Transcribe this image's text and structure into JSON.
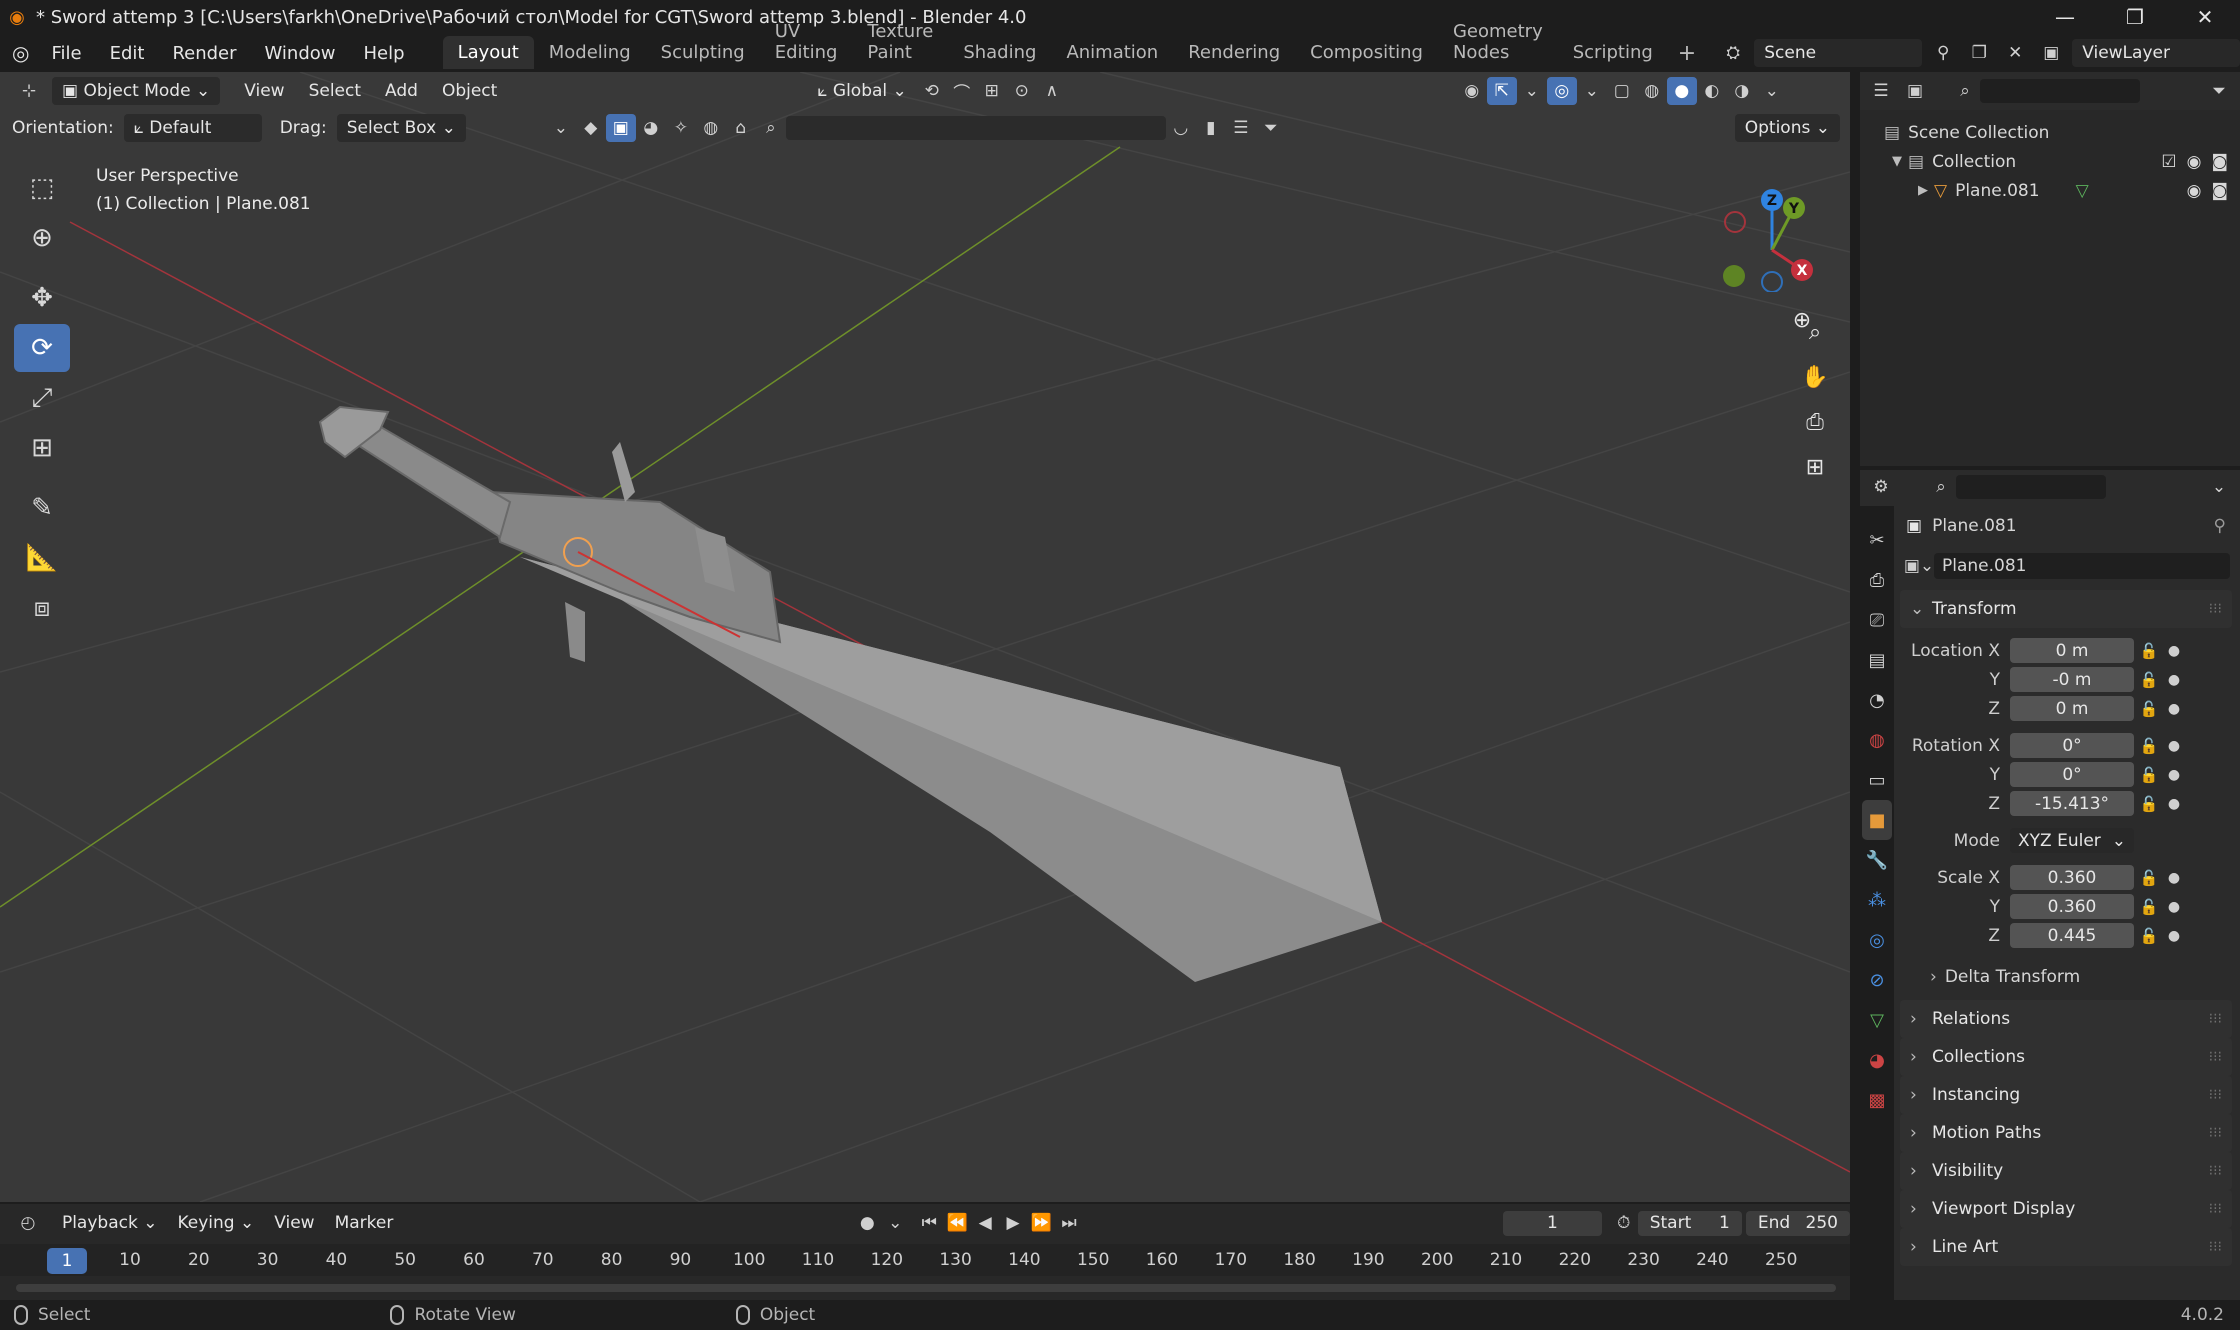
{
  "window": {
    "title": "* Sword attemp 3 [C:\\Users\\farkh\\OneDrive\\Рабочий стол\\Model for CGT\\Sword attemp 3.blend] - Blender 4.0",
    "minimize": "—",
    "maximize": "❐",
    "close": "✕"
  },
  "menu": {
    "items": [
      "File",
      "Edit",
      "Render",
      "Window",
      "Help"
    ],
    "workspaces": [
      "Layout",
      "Modeling",
      "Sculpting",
      "UV Editing",
      "Texture Paint",
      "Shading",
      "Animation",
      "Rendering",
      "Compositing",
      "Geometry Nodes",
      "Scripting"
    ],
    "active_workspace": "Layout",
    "scene": "Scene",
    "view_layer": "ViewLayer"
  },
  "viewport": {
    "mode": "Object Mode",
    "menus": [
      "View",
      "Select",
      "Add",
      "Object"
    ],
    "transform_orientation": "Global",
    "orientation_label": "Orientation:",
    "orientation_value": "Default",
    "drag_label": "Drag:",
    "drag_value": "Select Box",
    "options": "Options",
    "info_line1": "User Perspective",
    "info_line2": "(1) Collection | Plane.081",
    "gizmo_axes": [
      "Z",
      "Y",
      "X"
    ]
  },
  "outliner": {
    "rows": [
      {
        "label": "Scene Collection"
      },
      {
        "label": "Collection"
      },
      {
        "label": "Plane.081"
      }
    ]
  },
  "properties": {
    "object_name": "Plane.081",
    "datablock_name": "Plane.081",
    "transform_title": "Transform",
    "location": {
      "label": "Location X",
      "x": "0 m",
      "y": "-0 m",
      "z": "0 m"
    },
    "rotation": {
      "label": "Rotation X",
      "x": "0°",
      "y": "0°",
      "z": "-15.413°"
    },
    "mode_label": "Mode",
    "mode_value": "XYZ Euler",
    "scale": {
      "label": "Scale X",
      "x": "0.360",
      "y": "0.360",
      "z": "0.445"
    },
    "axis_y": "Y",
    "axis_z": "Z",
    "delta_transform": "Delta Transform",
    "panels": [
      "Relations",
      "Collections",
      "Instancing",
      "Motion Paths",
      "Visibility",
      "Viewport Display",
      "Line Art"
    ]
  },
  "timeline": {
    "menus": [
      "Playback",
      "Keying",
      "View",
      "Marker"
    ],
    "current_frame": "1",
    "start_label": "Start",
    "start": "1",
    "end_label": "End",
    "end": "250",
    "ticks": [
      "10",
      "20",
      "30",
      "40",
      "50",
      "60",
      "70",
      "80",
      "90",
      "100",
      "110",
      "120",
      "130",
      "140",
      "150",
      "160",
      "170",
      "180",
      "190",
      "200",
      "210",
      "220",
      "230",
      "240",
      "250"
    ],
    "cursor": "1"
  },
  "status": {
    "select": "Select",
    "rotate": "Rotate View",
    "object": "Object",
    "version": "4.0.2"
  },
  "colors": {
    "accent": "#4772b3",
    "x_axis": "#c5303d",
    "y_axis": "#6e9a26",
    "z_axis": "#2f83e0",
    "viewport_bg": "#393939"
  }
}
